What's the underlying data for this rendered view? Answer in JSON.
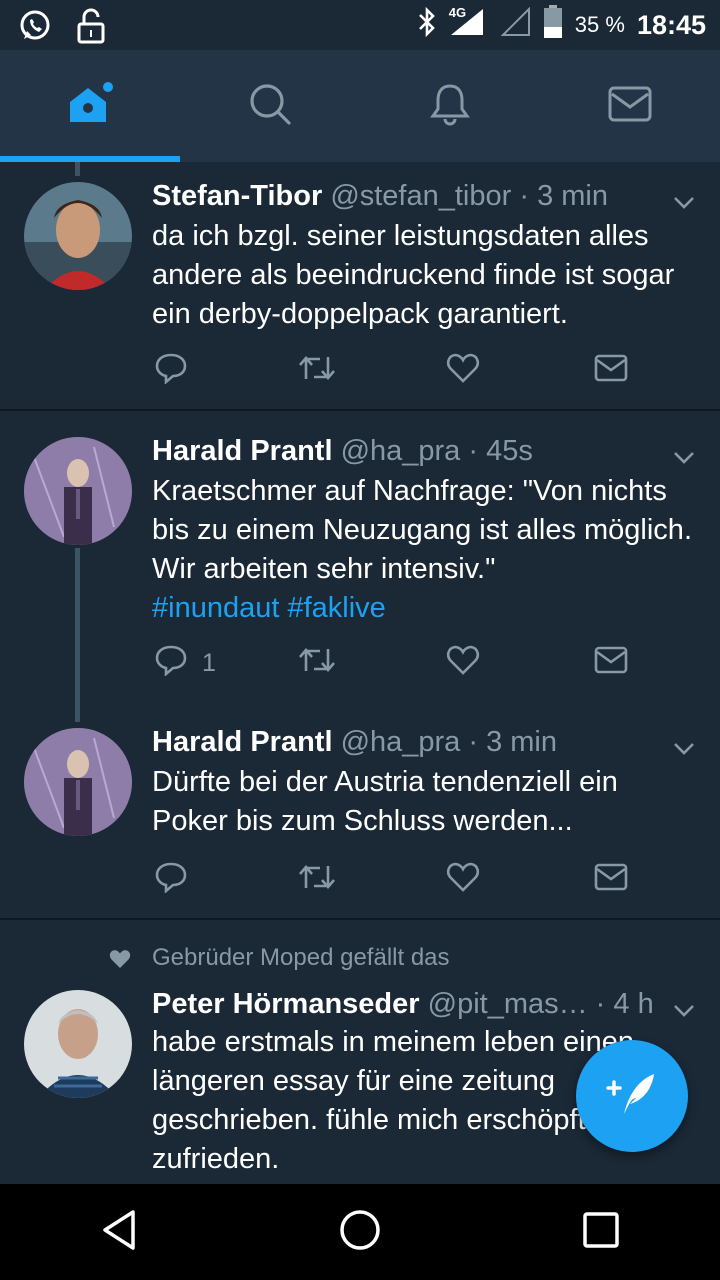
{
  "status_bar": {
    "left_icons": [
      "whatsapp-icon",
      "lock-icon"
    ],
    "network": "4G",
    "battery": "35 %",
    "time": "18:45"
  },
  "tabs": [
    {
      "name": "home",
      "icon": "home-icon",
      "active": true
    },
    {
      "name": "search",
      "icon": "search-icon",
      "active": false
    },
    {
      "name": "notifications",
      "icon": "bell-icon",
      "active": false
    },
    {
      "name": "messages",
      "icon": "mail-icon",
      "active": false
    }
  ],
  "tweets": [
    {
      "name": "Stefan-Tibor",
      "handle": "@stefan_tibor",
      "time": " · 3 min",
      "text": "da ich bzgl. seiner leistungsdaten alles andere als beeindruckend finde ist sogar ein derby-doppelpack garantiert.",
      "reply_count": ""
    },
    {
      "name": "Harald Prantl",
      "handle": "@ha_pra",
      "time": " · 45s",
      "text": "Kraetschmer auf Nachfrage: \"Von nichts bis zu einem Neuzugang ist alles möglich. Wir arbeiten sehr intensiv.\"",
      "hashtags": "#inundaut #faklive",
      "reply_count": "1"
    },
    {
      "name": "Harald Prantl",
      "handle": "@ha_pra",
      "time": " · 3 min",
      "text": "Dürfte bei der Austria tendenziell ein Poker bis zum Schluss werden...",
      "reply_count": ""
    },
    {
      "social_context": "Gebrüder Moped gefällt das",
      "name": "Peter Hörmanseder",
      "handle": "@pit_mas…",
      "time": " · 4 h",
      "text": "habe erstmals in meinem leben einen längeren essay für eine zeitung geschrieben. fühle mich erschöpft und zufrieden."
    }
  ],
  "colors": {
    "accent": "#1da1f2",
    "background": "#1b2836",
    "tabbar": "#243447",
    "secondary_text": "#8899a6"
  }
}
